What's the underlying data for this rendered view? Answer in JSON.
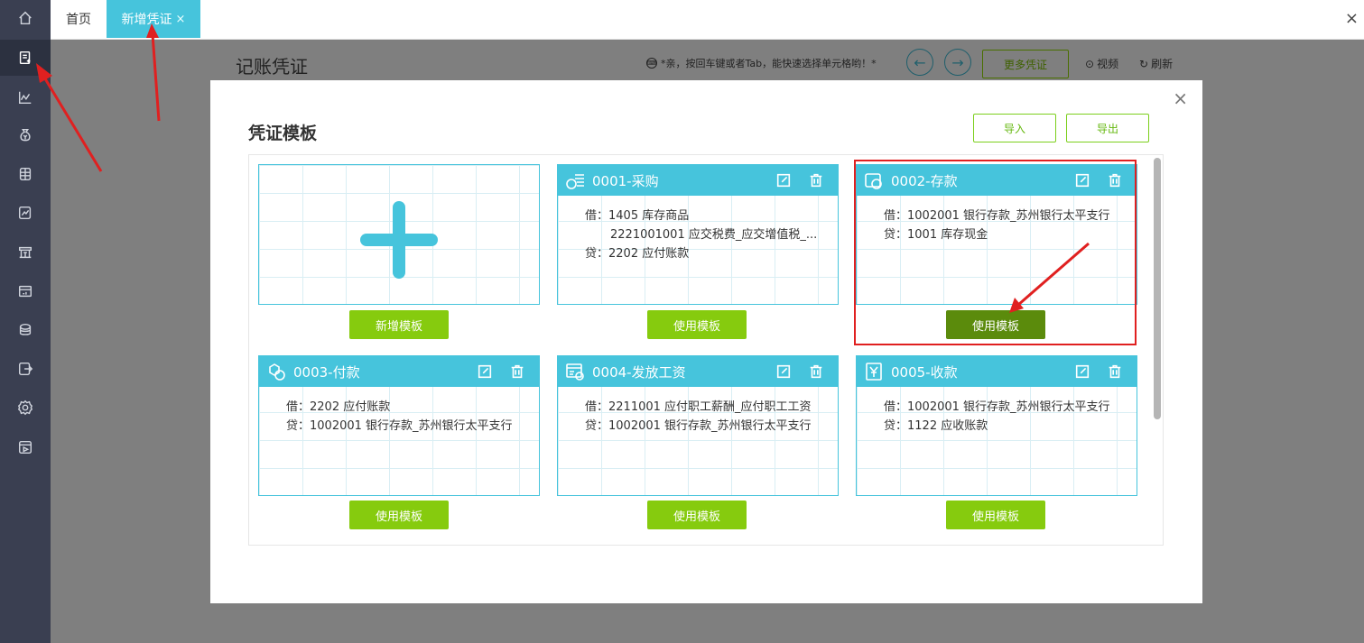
{
  "sidebar": {
    "items": [
      {
        "id": "home",
        "icon": "home-icon"
      },
      {
        "id": "voucher",
        "icon": "voucher-icon",
        "active": true
      },
      {
        "id": "chart",
        "icon": "line-chart-icon"
      },
      {
        "id": "money",
        "icon": "money-bag-icon"
      },
      {
        "id": "books",
        "icon": "ledger-icon"
      },
      {
        "id": "report",
        "icon": "report-icon"
      },
      {
        "id": "tax",
        "icon": "building-icon"
      },
      {
        "id": "assets",
        "icon": "assets-icon"
      },
      {
        "id": "salary",
        "icon": "salary-icon"
      },
      {
        "id": "export",
        "icon": "export-icon"
      },
      {
        "id": "settings",
        "icon": "gear-icon"
      },
      {
        "id": "video",
        "icon": "video-icon"
      }
    ]
  },
  "tabs": {
    "home": "首页",
    "active": "新增凭证",
    "close": "×"
  },
  "window_close": "×",
  "page": {
    "title": "记账凭证",
    "hint": "*亲，按回车键或者Tab，能快速选择单元格哟！*",
    "more_button": "更多凭证",
    "video": "视频",
    "refresh": "刷新"
  },
  "modal": {
    "title": "凭证模板",
    "close": "×",
    "import": "导入",
    "export": "导出",
    "new_card_button": "新增模板",
    "use_button": "使用模板",
    "templates": [
      {
        "name": "0001-采购",
        "icon": "purchase-icon",
        "lines": [
          "借：1405 库存商品",
          "2221001001 应交税费_应交增值税_...",
          "贷：2202 应付账款"
        ]
      },
      {
        "name": "0002-存款",
        "icon": "deposit-icon",
        "lines": [
          "借：1002001 银行存款_苏州银行太平支行",
          "贷：1001 库存现金"
        ]
      },
      {
        "name": "0003-付款",
        "icon": "payment-icon",
        "lines": [
          "借：2202 应付账款",
          "贷：1002001 银行存款_苏州银行太平支行"
        ]
      },
      {
        "name": "0004-发放工资",
        "icon": "payroll-icon",
        "lines": [
          "借：2211001 应付职工薪酬_应付职工工资",
          "贷：1002001 银行存款_苏州银行太平支行"
        ]
      },
      {
        "name": "0005-收款",
        "icon": "receipt-icon",
        "lines": [
          "借：1002001 银行存款_苏州银行太平支行",
          "贷：1122 应收账款"
        ]
      }
    ]
  },
  "colors": {
    "sidebar": "#3a3f51",
    "accent": "#46c4dc",
    "green": "#86cb0e",
    "green_dark": "#5b8b0c",
    "annotation": "#e02020"
  }
}
